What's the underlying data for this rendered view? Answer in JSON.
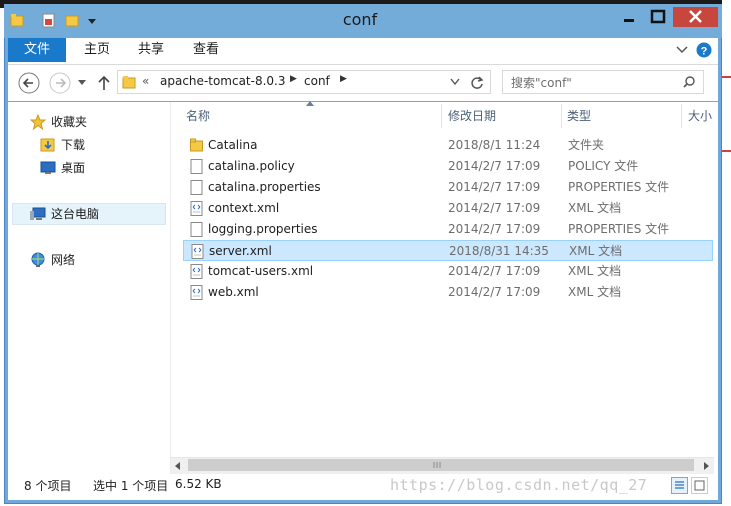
{
  "window": {
    "title": "conf"
  },
  "ribbon": {
    "tabs": [
      "文件",
      "主页",
      "共享",
      "查看"
    ]
  },
  "address": {
    "chevrons": "«",
    "parent": "apache-tomcat-8.0.3",
    "current": "conf"
  },
  "search": {
    "placeholder": "搜索\"conf\""
  },
  "nav": {
    "favorites": "收藏夹",
    "downloads": "下载",
    "desktop": "桌面",
    "this_pc": "这台电脑",
    "network": "网络"
  },
  "columns": {
    "name": "名称",
    "date": "修改日期",
    "type": "类型",
    "size": "大小"
  },
  "files": [
    {
      "name": "Catalina",
      "date": "2018/8/1 11:24",
      "type": "文件夹",
      "icon": "folder-icon"
    },
    {
      "name": "catalina.policy",
      "date": "2014/2/7 17:09",
      "type": "POLICY 文件",
      "icon": "file-icon"
    },
    {
      "name": "catalina.properties",
      "date": "2014/2/7 17:09",
      "type": "PROPERTIES 文件",
      "icon": "file-icon"
    },
    {
      "name": "context.xml",
      "date": "2014/2/7 17:09",
      "type": "XML 文档",
      "icon": "xml-file-icon"
    },
    {
      "name": "logging.properties",
      "date": "2014/2/7 17:09",
      "type": "PROPERTIES 文件",
      "icon": "file-icon"
    },
    {
      "name": "server.xml",
      "date": "2018/8/31 14:35",
      "type": "XML 文档",
      "icon": "xml-file-icon",
      "selected": true
    },
    {
      "name": "tomcat-users.xml",
      "date": "2014/2/7 17:09",
      "type": "XML 文档",
      "icon": "xml-file-icon"
    },
    {
      "name": "web.xml",
      "date": "2014/2/7 17:09",
      "type": "XML 文档",
      "icon": "xml-file-icon"
    }
  ],
  "status": {
    "count": "8 个项目",
    "selected": "选中 1 个项目",
    "size": "6.52 KB"
  },
  "watermark": "https://blog.csdn.net/qq_27",
  "colors": {
    "accent": "#1979ca",
    "titlebar": "#74acd9",
    "close": "#c7463e",
    "selection": "#cce8ff"
  }
}
